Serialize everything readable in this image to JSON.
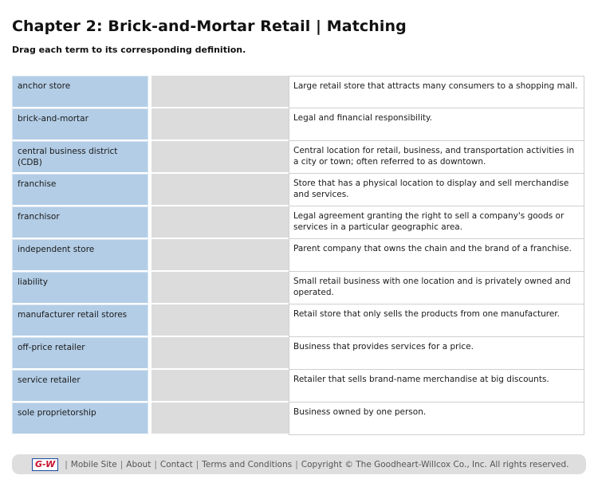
{
  "title": "Chapter 2: Brick-and-Mortar Retail | Matching",
  "instructions": "Drag each term to its corresponding definition.",
  "rows": [
    {
      "term": "anchor store",
      "definition": "Large retail store that attracts many consumers to a shopping mall."
    },
    {
      "term": "brick-and-mortar",
      "definition": "Legal and financial responsibility."
    },
    {
      "term": "central business district (CDB)",
      "definition": "Central location for retail, business, and transportation activities in a city or town; often referred to as downtown."
    },
    {
      "term": "franchise",
      "definition": "Store that has a physical location to display and sell merchandise and services."
    },
    {
      "term": "franchisor",
      "definition": "Legal agreement granting the right to sell a company's goods or services in a particular geographic area."
    },
    {
      "term": "independent store",
      "definition": "Parent company that owns the chain and the brand of a franchise."
    },
    {
      "term": "liability",
      "definition": "Small retail business with one location and is privately owned and operated."
    },
    {
      "term": "manufacturer retail stores",
      "definition": "Retail store that only sells the products from one manufacturer."
    },
    {
      "term": "off-price retailer",
      "definition": "Business that provides services for a price."
    },
    {
      "term": "service retailer",
      "definition": "Retailer that sells brand-name merchandise at big discounts."
    },
    {
      "term": "sole proprietorship",
      "definition": "Business owned by one person."
    }
  ],
  "footer": {
    "logo": "G-W",
    "links": [
      "Mobile Site",
      "About",
      "Contact",
      "Terms and Conditions"
    ],
    "copyright": "Copyright © The Goodheart-Willcox Co., Inc. All rights reserved."
  }
}
